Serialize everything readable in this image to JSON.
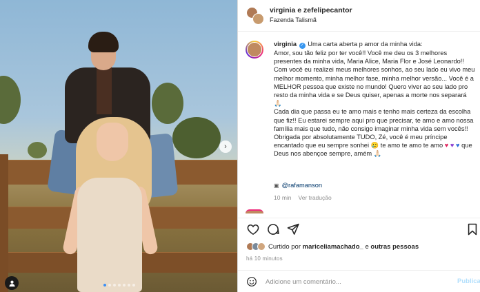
{
  "post": {
    "header": {
      "username": "virginia e zefelipecantor",
      "location": "Fazenda Talismã"
    },
    "caption": {
      "username": "virginia",
      "lines": [
        "Uma carta aberta p amor da minha vida:",
        "Amor, sou tão feliz por ter você!! Você me deu os 3 melhores presentes da minha vida, Maria Alice, Maria Flor e José Leonardo!! Com você eu realizei meus melhores sonhos, ao seu lado eu vivo meu melhor momento, minha melhor fase, minha melhor versão... Você é a MELHOR pessoa que existe no mundo! Quero viver ao seu lado pro resto da minha vida e se Deus quiser, apenas a morte nos separará 🙏🏻",
        "Cada dia que passa eu te amo mais e tenho mais certeza da escolha que fiz!! Eu estarei sempre aqui pro que precisar, te amo e amo nossa família mais que tudo, não consigo imaginar minha vida sem vocês!! Obrigada por absolutamente TUDO, Zé, você é meu príncipe encantado que eu sempre sonhei 🥲 te amo te amo te amo",
        "que Deus nos abençoe sempre, amém 🙏🏻"
      ],
      "mention": "@rafamanson",
      "time": "10 min",
      "translate": "Ver tradução"
    },
    "likes": {
      "prefix": "Curtido por",
      "user": "mariceliamachado_",
      "suffix": "e",
      "others": "outras pessoas"
    },
    "timestamp": "há 10 minutos",
    "comment": {
      "placeholder": "Adicione um comentário...",
      "publish": "Publica"
    }
  },
  "carousel": {
    "count": 7,
    "active": 0
  },
  "colors": {
    "accent": "#3897f0",
    "link": "#00376b",
    "muted": "#8e8e8e"
  },
  "icons": [
    "heart-icon",
    "comment-icon",
    "share-icon",
    "bookmark-icon",
    "emoji-icon",
    "user-tag-icon",
    "chevron-right-icon",
    "verified-badge-icon"
  ]
}
